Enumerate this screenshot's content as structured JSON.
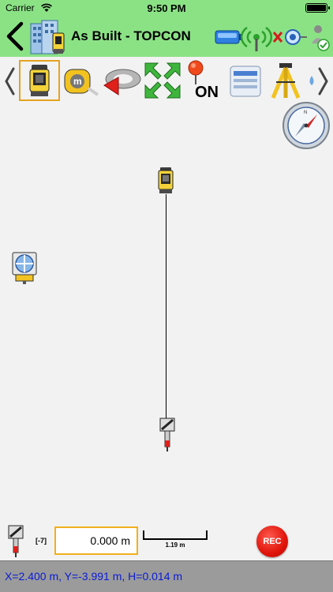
{
  "status_bar": {
    "carrier": "Carrier",
    "time": "9:50 PM",
    "icons": [
      "wifi-icon",
      "battery-icon"
    ]
  },
  "header": {
    "title": "As Built - TOPCON",
    "background_color": "#8be285",
    "icons": [
      "back-chevron-icon",
      "building-instrument-icon",
      "battery-connection-icon",
      "radio-signal-icon",
      "prism-link-icon",
      "user-check-icon"
    ]
  },
  "toolbar": {
    "selected_tool": "instrument",
    "selected_border_color": "#e6a321",
    "pin_label": "ON",
    "items": [
      "prev-chevron-icon",
      "total-station-icon",
      "tape-measure-icon",
      "rotate-arrow-icon",
      "zoom-extents-icon",
      "pin-icon",
      "list-icon",
      "tripod-icon",
      "next-chevron-icon"
    ]
  },
  "map": {
    "compass": "compass-icon",
    "points": [
      "total-station-icon",
      "prism-target-icon",
      "prism-rod-icon"
    ]
  },
  "controls": {
    "offset_label": "[-7]",
    "height_value": "0.000 m",
    "scale_label": "1.19 m",
    "rec_label": "REC",
    "rec_color": "#e0140a"
  },
  "coordinates": {
    "text": "X=2.400 m, Y=-3.991 m, H=0.014 m",
    "text_color": "#0b1cd4"
  }
}
